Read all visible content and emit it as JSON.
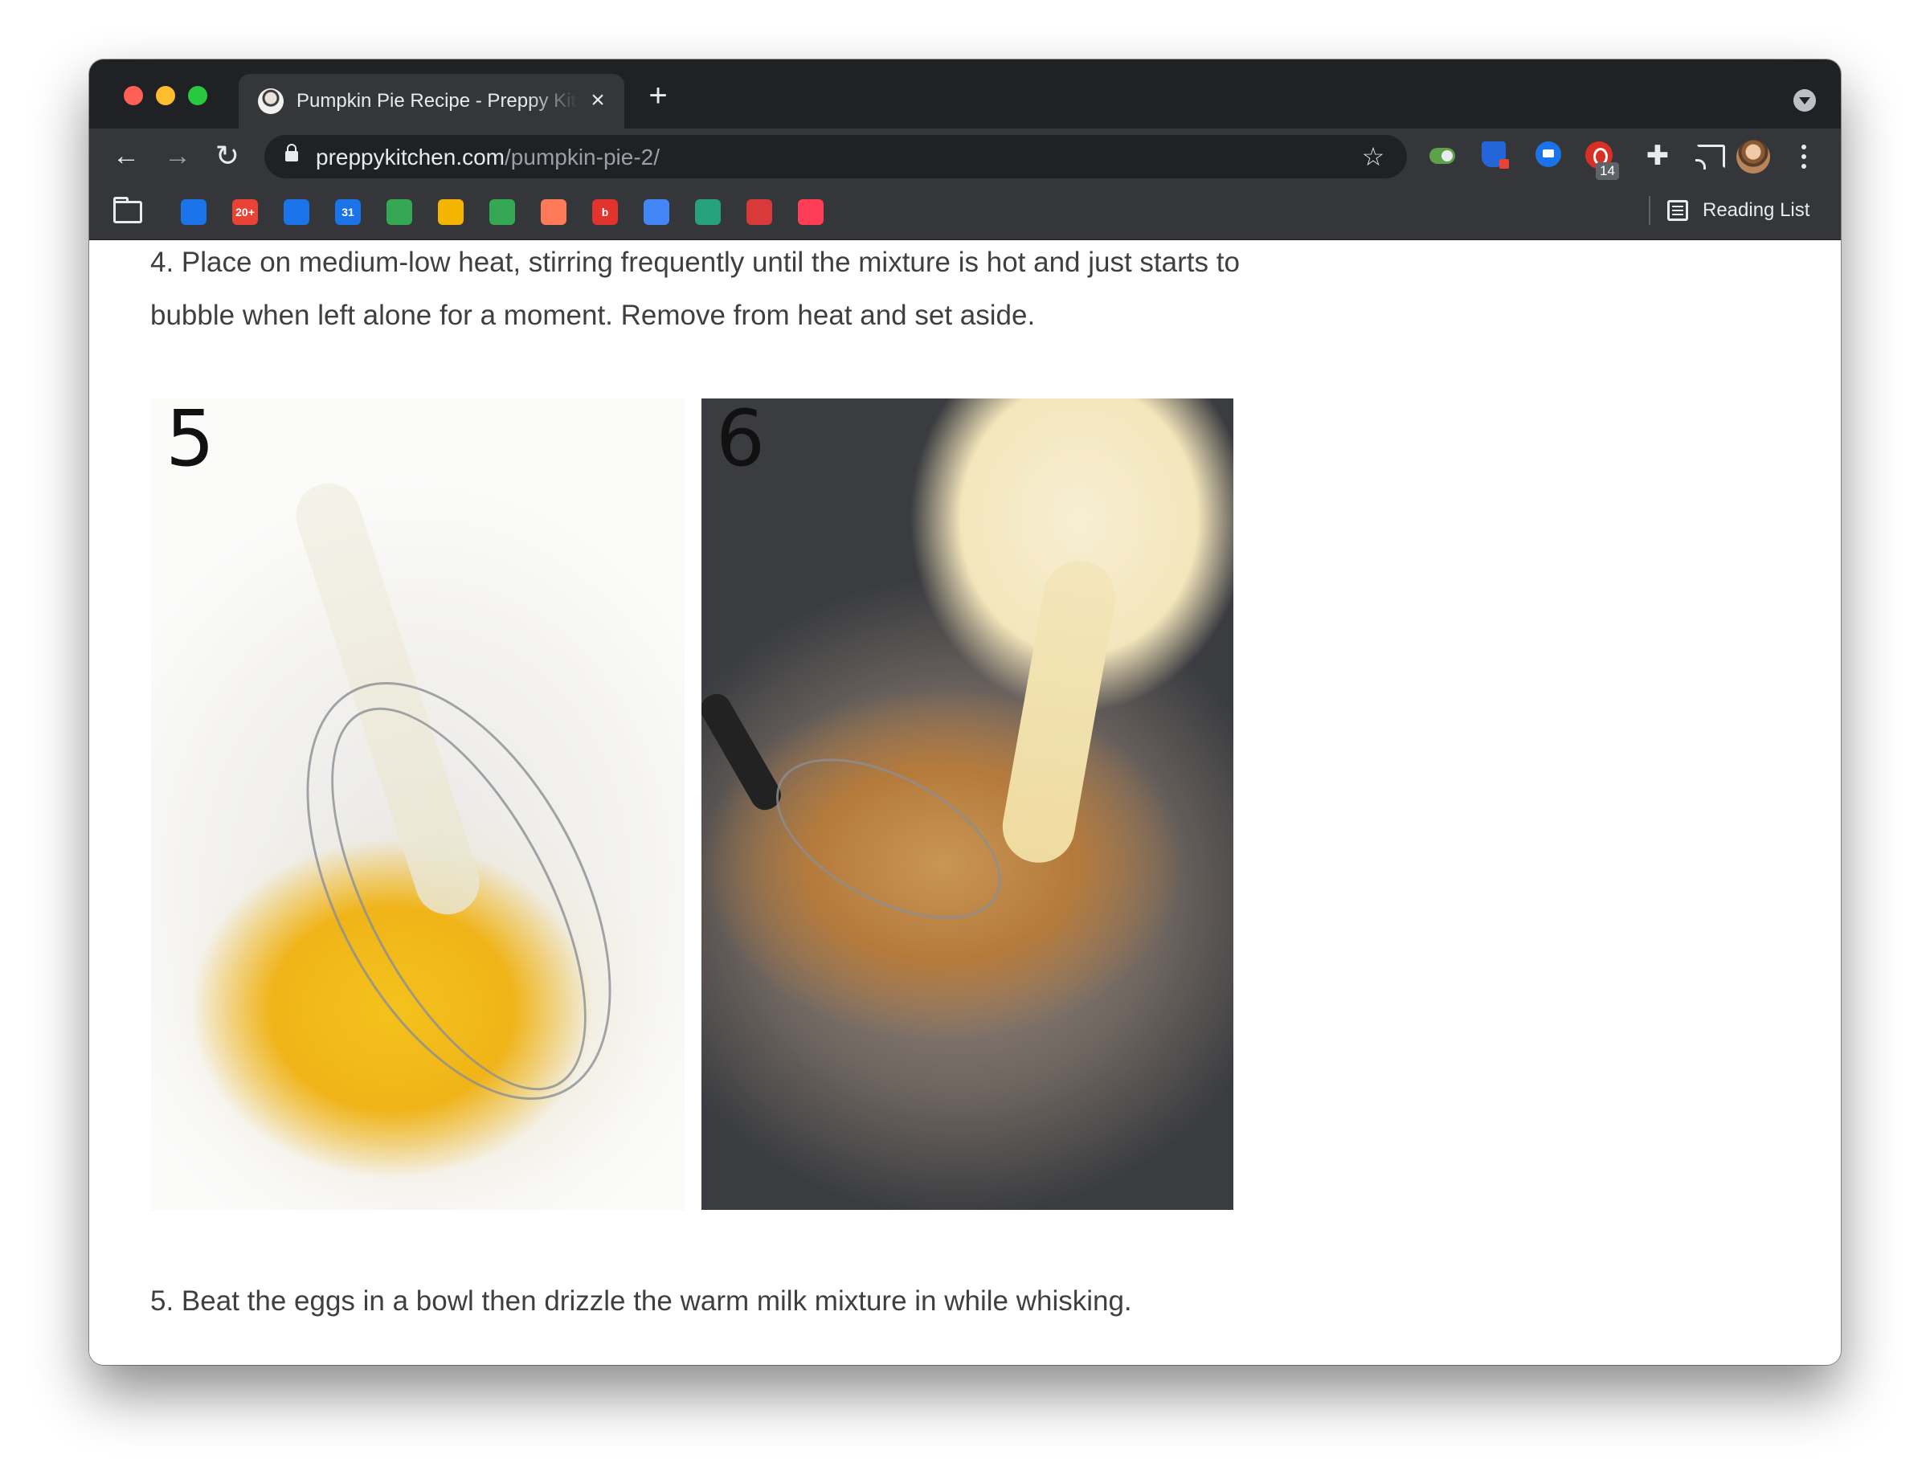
{
  "browser": {
    "tab": {
      "title": "Pumpkin Pie Recipe - Preppy Kitchen"
    },
    "url": {
      "domain": "preppykitchen.com",
      "path": "/pumpkin-pie-2/"
    },
    "extension_badge": "14",
    "bookmarks": [
      {
        "icon": "contacts-icon",
        "color": "#1a73e8",
        "label": ""
      },
      {
        "icon": "gmail-icon",
        "color": "#ea4335",
        "label": "20+"
      },
      {
        "icon": "chat-icon",
        "color": "#1a73e8",
        "label": ""
      },
      {
        "icon": "calendar-icon",
        "color": "#1a73e8",
        "label": "31"
      },
      {
        "icon": "phone-icon",
        "color": "#34a853",
        "label": ""
      },
      {
        "icon": "sheets-icon",
        "color": "#f4b400",
        "label": ""
      },
      {
        "icon": "drive-icon",
        "color": "#34a853",
        "label": ""
      },
      {
        "icon": "hubspot-icon",
        "color": "#ff7a59",
        "label": ""
      },
      {
        "icon": "b-app-icon",
        "color": "#e2332c",
        "label": "b"
      },
      {
        "icon": "grid-app-icon",
        "color": "#4285f4",
        "label": ""
      },
      {
        "icon": "wave-app-icon",
        "color": "#26a17b",
        "label": ""
      },
      {
        "icon": "trello-icon",
        "color": "#d83a3a",
        "label": ""
      },
      {
        "icon": "monday-icon",
        "color": "#ff3d57",
        "label": ""
      }
    ],
    "reading_list_label": "Reading List"
  },
  "article": {
    "step4_text": "4. Place on medium-low heat, stirring frequently until the mixture is hot and just starts to bubble when left alone for a moment. Remove from heat and set aside.",
    "photos": [
      {
        "number": "5"
      },
      {
        "number": "6"
      }
    ],
    "step5_text": "5. Beat the eggs in a bowl then drizzle the warm milk mixture in while whisking."
  }
}
